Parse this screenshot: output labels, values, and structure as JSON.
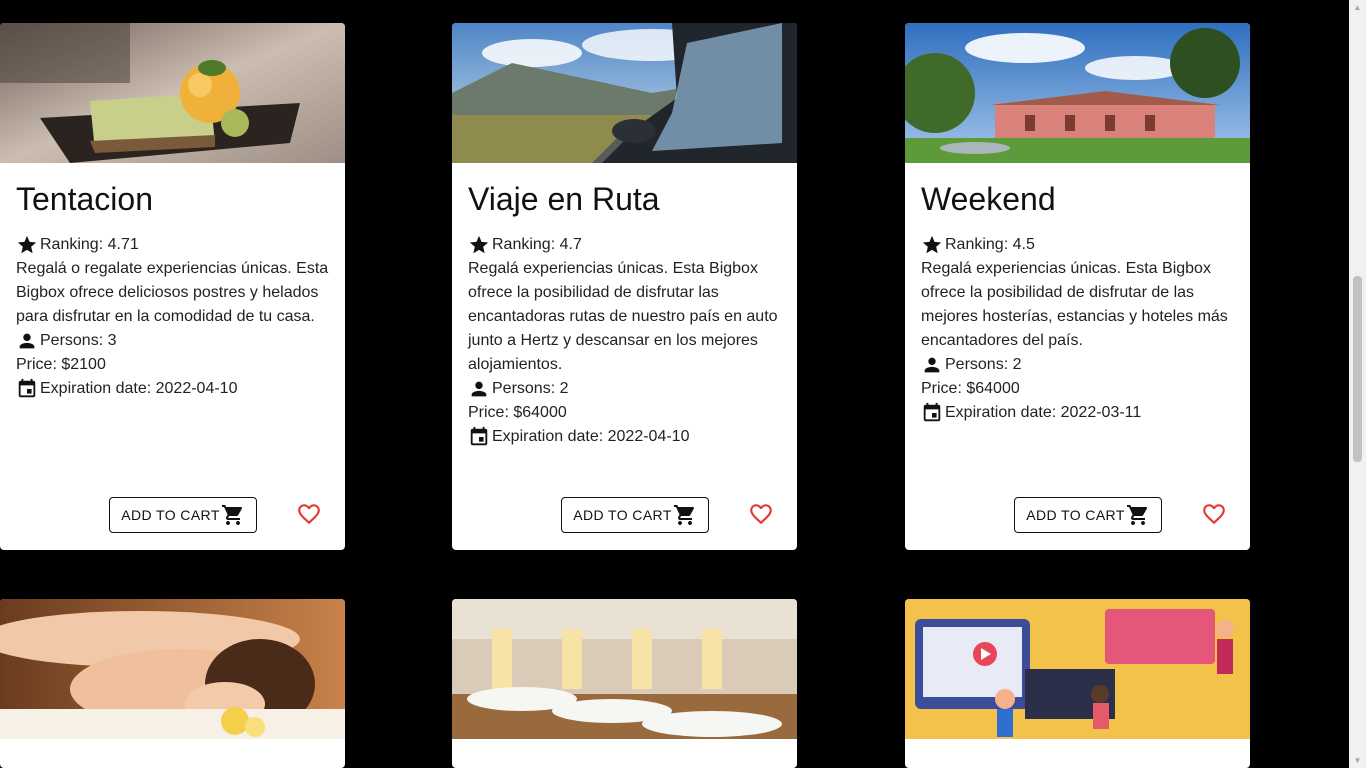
{
  "cards": [
    {
      "title": "Tentacion",
      "ranking": "Ranking: 4.71",
      "description": "Regalá o regalate experiencias únicas. Esta Bigbox ofrece deliciosos postres y helados para disfrutar en la comodidad de tu casa.",
      "persons": "Persons: 3",
      "price": "Price: $2100",
      "expiration": "Expiration date: 2022-04-10",
      "button": "ADD TO CART"
    },
    {
      "title": "Viaje en Ruta",
      "ranking": "Ranking: 4.7",
      "description": "Regalá experiencias únicas. Esta Bigbox ofrece la posibilidad de disfrutar las encantadoras rutas de nuestro país en auto junto a Hertz y descansar en los mejores alojamientos.",
      "persons": "Persons: 2",
      "price": "Price: $64000",
      "expiration": "Expiration date: 2022-04-10",
      "button": "ADD TO CART"
    },
    {
      "title": "Weekend",
      "ranking": "Ranking: 4.5",
      "description": "Regalá experiencias únicas. Esta Bigbox ofrece la posibilidad de disfrutar de las mejores hosterías, estancias y hoteles más encantadores del país.",
      "persons": "Persons: 2",
      "price": "Price: $64000",
      "expiration": "Expiration date: 2022-03-11",
      "button": "ADD TO CART"
    }
  ],
  "icons": {
    "ranking": "star-icon",
    "persons": "person-icon",
    "expiration": "calendar-icon",
    "cart": "cart-icon",
    "favorite": "heart-outline-icon"
  },
  "colors": {
    "background": "#000000",
    "card": "#ffffff",
    "favorite": "#e53935"
  }
}
